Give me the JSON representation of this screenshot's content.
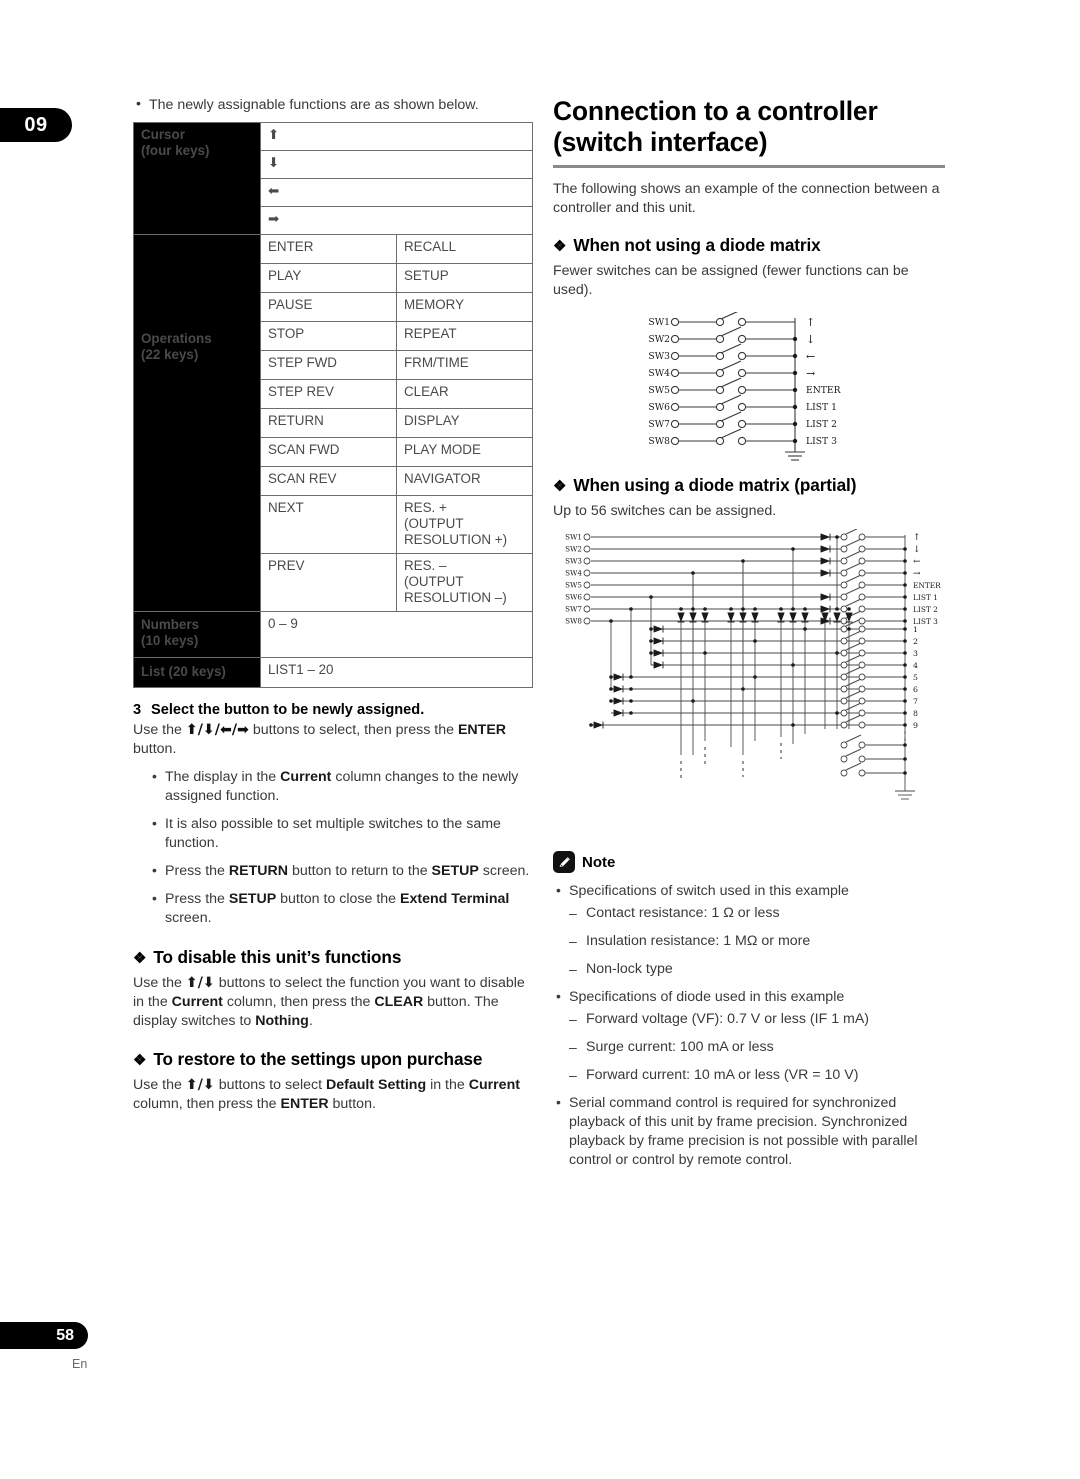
{
  "chapter_tab": "09",
  "page_number": "58",
  "page_lang": "En",
  "left": {
    "intro_bullet": "The newly assignable functions are as shown below.",
    "table": {
      "cursor_label": "Cursor\n(four keys)",
      "cursor_label_line1": "Cursor",
      "cursor_label_line2": "(four keys)",
      "cursor_rows": [
        "⬆",
        "⬇",
        "⬅",
        "➡"
      ],
      "operations_label_line1": "Operations",
      "operations_label_line2": "(22 keys)",
      "operations_rows": [
        [
          "ENTER",
          "RECALL"
        ],
        [
          "PLAY",
          "SETUP"
        ],
        [
          "PAUSE",
          "MEMORY"
        ],
        [
          "STOP",
          "REPEAT"
        ],
        [
          "STEP FWD",
          "FRM/TIME"
        ],
        [
          "STEP REV",
          "CLEAR"
        ],
        [
          "RETURN",
          "DISPLAY"
        ],
        [
          "SCAN FWD",
          "PLAY MODE"
        ],
        [
          "SCAN REV",
          "NAVIGATOR"
        ],
        [
          "NEXT",
          "RES. +\n(OUTPUT RESOLUTION +)"
        ],
        [
          "PREV",
          "RES. –\n(OUTPUT RESOLUTION –)"
        ]
      ],
      "numbers_label_line1": "Numbers",
      "numbers_label_line2": "(10 keys)",
      "numbers_value": "0 – 9",
      "list_label": "List (20 keys)",
      "list_value": "LIST1 – 20"
    },
    "step3": {
      "number": "3",
      "title": "Select the button to be newly assigned.",
      "body_1": "Use the ",
      "body_arrows": "⬆/⬇/⬅/➡",
      "body_2": " buttons to select, then press the ",
      "body_bold": "ENTER",
      "body_3": " button."
    },
    "step3_bullets": [
      "The display in the Current column changes to the newly assigned function.",
      "It is also possible to set multiple switches to the same function.",
      "Press the RETURN button to return to the SETUP screen.",
      "Press the SETUP button to close the Extend Terminal screen."
    ],
    "disable_section": {
      "heading": "To disable this unit’s functions",
      "body": "Use the ⬆/⬇ buttons to select the function you want to disable in the Current column, then press the CLEAR button. The display switches to Nothing."
    },
    "restore_section": {
      "heading": "To restore to the settings upon purchase",
      "body": "Use the ⬆/⬇ buttons to select Default Setting in the Current column, then press the ENTER button."
    }
  },
  "right": {
    "title_line1": "Connection to a controller",
    "title_line2": "(switch interface)",
    "intro": "The following shows an example of the connection between a controller and this unit.",
    "no_diode": {
      "heading": "When not using a diode matrix",
      "body": "Fewer switches can be assigned (fewer functions can be used)."
    },
    "diagram1": {
      "switch_labels": [
        "SW1",
        "SW2",
        "SW3",
        "SW4",
        "SW5",
        "SW6",
        "SW7",
        "SW8"
      ],
      "output_labels": [
        "↑",
        "↓",
        "←",
        "→",
        "ENTER",
        "LIST 1",
        "LIST 2",
        "LIST 3"
      ]
    },
    "diode": {
      "heading": "When using a diode matrix (partial)",
      "body": "Up to 56 switches can be assigned."
    },
    "diagram2": {
      "switch_labels": [
        "SW1",
        "SW2",
        "SW3",
        "SW4",
        "SW5",
        "SW6",
        "SW7",
        "SW8"
      ],
      "output_labels_top": [
        "↑",
        "↓",
        "←",
        "→",
        "ENTER",
        "LIST 1",
        "LIST 2",
        "LIST 3"
      ],
      "output_labels_bottom": [
        "1",
        "2",
        "3",
        "4",
        "5",
        "6",
        "7",
        "8",
        "9"
      ]
    },
    "note": {
      "label": "Note",
      "items": [
        {
          "text": "Specifications of switch used in this example",
          "sub": [
            "Contact resistance: 1 Ω or less",
            "Insulation resistance: 1 MΩ or more",
            "Non-lock type"
          ]
        },
        {
          "text": "Specifications of diode used in this example",
          "sub": [
            "Forward voltage (VF): 0.7 V or less (IF 1 mA)",
            "Surge current: 100 mA or less",
            "Forward current: 10 mA or less (VR = 10 V)"
          ]
        },
        {
          "text": "Serial command control is required for synchronized playback of this unit by frame precision. Synchronized playback by frame precision is not possible with parallel control or control by remote control.",
          "sub": []
        }
      ]
    }
  }
}
